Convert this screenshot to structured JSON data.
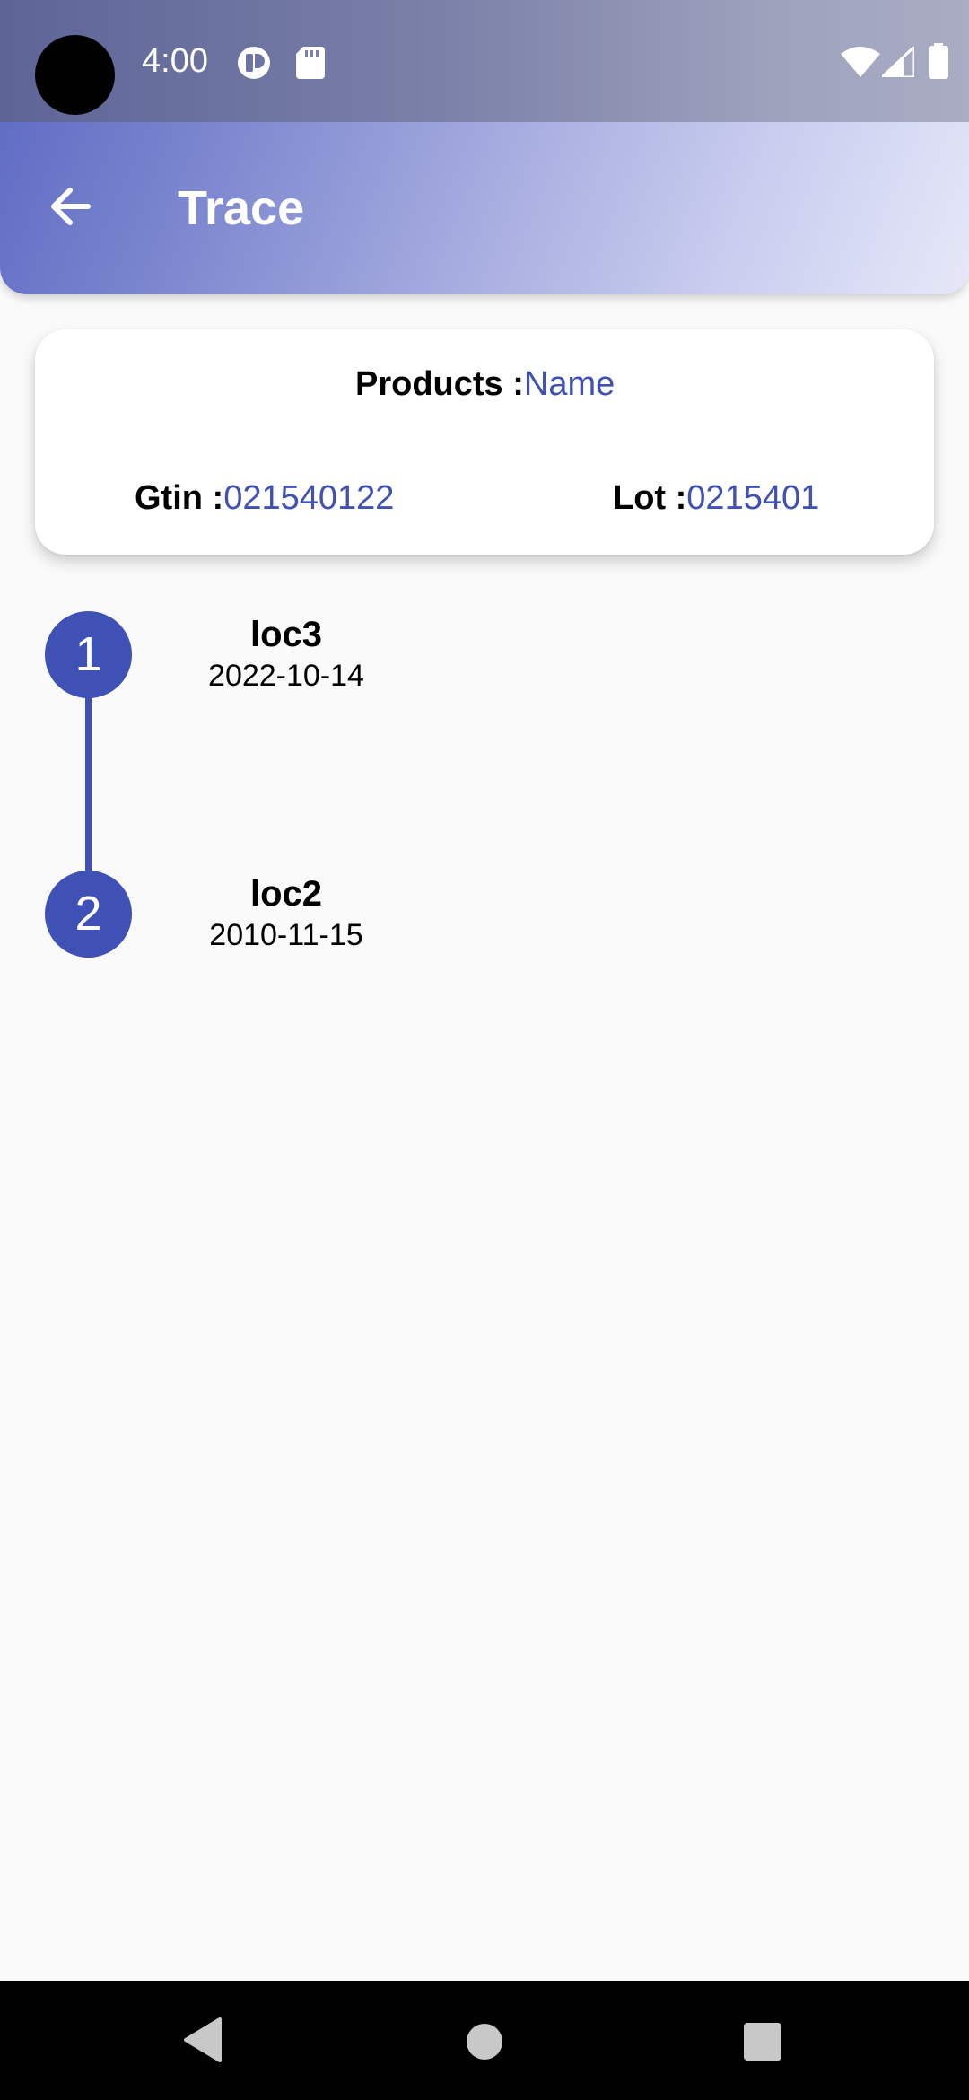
{
  "status_bar": {
    "time": "4:00",
    "left_icons": [
      "camera-hole-icon",
      "app-notification-icon",
      "sd-card-icon"
    ],
    "right_icons": [
      "wifi-icon",
      "cell-signal-icon",
      "battery-icon"
    ]
  },
  "app_bar": {
    "title": "Trace",
    "back_icon": "arrow-back-icon"
  },
  "product_card": {
    "products_label": "Products :",
    "products_value": "Name",
    "gtin_label": "Gtin :",
    "gtin_value": "021540122",
    "lot_label": "Lot :",
    "lot_value": "0215401"
  },
  "timeline": [
    {
      "step": "1",
      "location": "loc3",
      "date": "2022-10-14"
    },
    {
      "step": "2",
      "location": "loc2",
      "date": "2010-11-15"
    }
  ],
  "nav_bar": {
    "buttons": [
      "back-triangle-icon",
      "home-circle-icon",
      "recents-square-icon"
    ]
  },
  "colors": {
    "accent": "#3f51b5",
    "header_gradient_start": "#5b67c2",
    "header_gradient_end": "#e6e8f8",
    "background": "#fafafa"
  }
}
